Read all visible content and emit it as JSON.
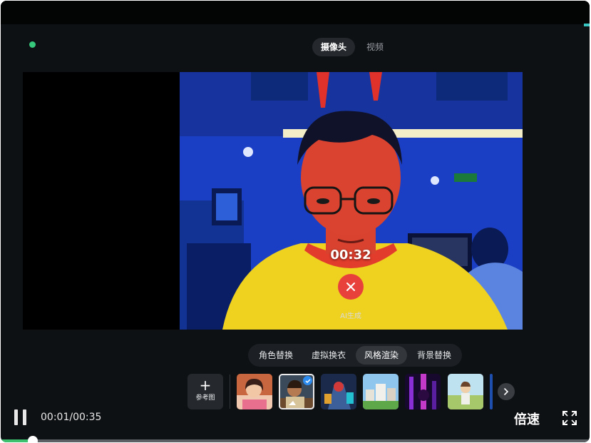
{
  "header": {
    "mode_tabs": [
      {
        "label": "摄像头",
        "active": true
      },
      {
        "label": "视频",
        "active": false
      }
    ]
  },
  "camera": {
    "timer": "00:32",
    "overlay_label": "AI生成"
  },
  "feature_tabs": [
    {
      "label": "角色替换",
      "active": false
    },
    {
      "label": "虚拟换衣",
      "active": false
    },
    {
      "label": "风格渲染",
      "active": true
    },
    {
      "label": "背景替换",
      "active": false
    }
  ],
  "reference_button": {
    "icon": "plus-icon",
    "label": "参考图"
  },
  "style_thumbnails": [
    {
      "name": "style-anime-girl",
      "selected": false
    },
    {
      "name": "style-cartoon-chef",
      "selected": true
    },
    {
      "name": "style-mecha",
      "selected": false
    },
    {
      "name": "style-city-street",
      "selected": false
    },
    {
      "name": "style-neon-night",
      "selected": false
    },
    {
      "name": "style-field-boy",
      "selected": false
    }
  ],
  "player": {
    "time_display": "00:01/00:35",
    "speed_label": "倍速",
    "progress": 0.054
  },
  "colors": {
    "accent_green": "#3ec16f",
    "stop_red": "#e8413c",
    "status_dot": "#36c97c",
    "select_blue": "#2d8cf0"
  }
}
